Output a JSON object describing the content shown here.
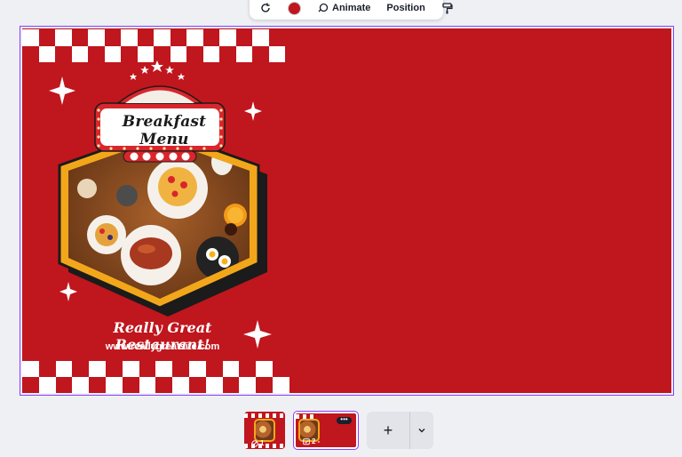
{
  "toolbar": {
    "animate_label": "Animate",
    "position_label": "Position",
    "fill_color": "#c0161d"
  },
  "design": {
    "background_color": "#c0161d",
    "menu_title": "Breakfast Menu",
    "headline": "Really Great Restaurant!",
    "website": "www.reallygreatsite.com",
    "accent_color": "#f2a71b"
  },
  "pages": {
    "page1_number": "1",
    "page2_number": "2 -",
    "more_label": "•••",
    "add_label": "+"
  }
}
